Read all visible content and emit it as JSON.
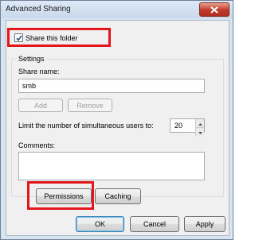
{
  "window": {
    "title": "Advanced Sharing"
  },
  "share": {
    "checkbox_label": "Share this folder",
    "checked": true
  },
  "settings": {
    "group_title": "Settings",
    "share_name_label": "Share name:",
    "share_name_value": "smb",
    "add_label": "Add",
    "remove_label": "Remove",
    "limit_label": "Limit the number of simultaneous users to:",
    "limit_value": "20",
    "comments_label": "Comments:",
    "comments_value": ""
  },
  "buttons": {
    "permissions": "Permissions",
    "caching": "Caching",
    "ok": "OK",
    "cancel": "Cancel",
    "apply": "Apply"
  },
  "colors": {
    "highlight": "#e3171b",
    "close_button": "#c0392b"
  }
}
